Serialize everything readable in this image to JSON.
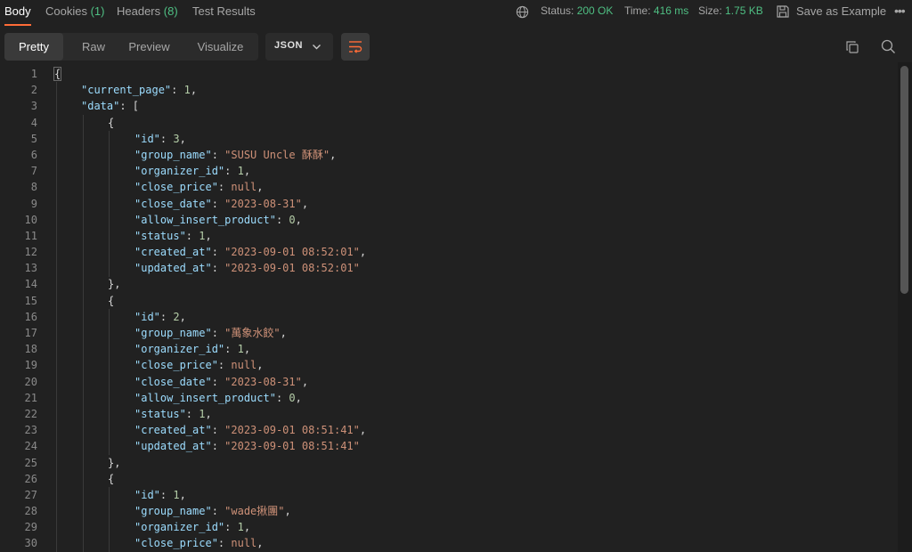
{
  "tabs": {
    "body": "Body",
    "cookies_label": "Cookies",
    "cookies_count": "(1)",
    "headers_label": "Headers",
    "headers_count": "(8)",
    "test_results": "Test Results"
  },
  "status_bar": {
    "status_label": "Status:",
    "status_value": "200 OK",
    "time_label": "Time:",
    "time_value": "416 ms",
    "size_label": "Size:",
    "size_value": "1.75 KB",
    "save_label": "Save as Example",
    "more": "•••"
  },
  "toolbar": {
    "views": [
      "Pretty",
      "Raw",
      "Preview",
      "Visualize"
    ],
    "active_view": "Pretty",
    "format": "JSON"
  },
  "colors": {
    "accent": "#ff6c37",
    "success": "#4fbf83",
    "key": "#9cdcfe",
    "string": "#ce9178",
    "number": "#b5cea8"
  },
  "icons": [
    "globe-icon",
    "save-icon",
    "chevron-down-icon",
    "wrap-lines-icon",
    "copy-icon",
    "search-icon",
    "more-icon"
  ],
  "code": {
    "lines": [
      {
        "n": "1",
        "indent": 0,
        "tokens": [
          [
            "pun",
            "{"
          ]
        ]
      },
      {
        "n": "2",
        "indent": 1,
        "tokens": [
          [
            "key",
            "\"current_page\""
          ],
          [
            "pun",
            ": "
          ],
          [
            "num",
            "1"
          ],
          [
            "pun",
            ","
          ]
        ]
      },
      {
        "n": "3",
        "indent": 1,
        "tokens": [
          [
            "key",
            "\"data\""
          ],
          [
            "pun",
            ": ["
          ]
        ]
      },
      {
        "n": "4",
        "indent": 2,
        "tokens": [
          [
            "pun",
            "{"
          ]
        ]
      },
      {
        "n": "5",
        "indent": 3,
        "tokens": [
          [
            "key",
            "\"id\""
          ],
          [
            "pun",
            ": "
          ],
          [
            "num",
            "3"
          ],
          [
            "pun",
            ","
          ]
        ]
      },
      {
        "n": "6",
        "indent": 3,
        "tokens": [
          [
            "key",
            "\"group_name\""
          ],
          [
            "pun",
            ": "
          ],
          [
            "str",
            "\"SUSU Uncle 酥酥\""
          ],
          [
            "pun",
            ","
          ]
        ]
      },
      {
        "n": "7",
        "indent": 3,
        "tokens": [
          [
            "key",
            "\"organizer_id\""
          ],
          [
            "pun",
            ": "
          ],
          [
            "num",
            "1"
          ],
          [
            "pun",
            ","
          ]
        ]
      },
      {
        "n": "8",
        "indent": 3,
        "tokens": [
          [
            "key",
            "\"close_price\""
          ],
          [
            "pun",
            ": "
          ],
          [
            "nul",
            "null"
          ],
          [
            "pun",
            ","
          ]
        ]
      },
      {
        "n": "9",
        "indent": 3,
        "tokens": [
          [
            "key",
            "\"close_date\""
          ],
          [
            "pun",
            ": "
          ],
          [
            "str",
            "\"2023-08-31\""
          ],
          [
            "pun",
            ","
          ]
        ]
      },
      {
        "n": "10",
        "indent": 3,
        "tokens": [
          [
            "key",
            "\"allow_insert_product\""
          ],
          [
            "pun",
            ": "
          ],
          [
            "num",
            "0"
          ],
          [
            "pun",
            ","
          ]
        ]
      },
      {
        "n": "11",
        "indent": 3,
        "tokens": [
          [
            "key",
            "\"status\""
          ],
          [
            "pun",
            ": "
          ],
          [
            "num",
            "1"
          ],
          [
            "pun",
            ","
          ]
        ]
      },
      {
        "n": "12",
        "indent": 3,
        "tokens": [
          [
            "key",
            "\"created_at\""
          ],
          [
            "pun",
            ": "
          ],
          [
            "str",
            "\"2023-09-01 08:52:01\""
          ],
          [
            "pun",
            ","
          ]
        ]
      },
      {
        "n": "13",
        "indent": 3,
        "tokens": [
          [
            "key",
            "\"updated_at\""
          ],
          [
            "pun",
            ": "
          ],
          [
            "str",
            "\"2023-09-01 08:52:01\""
          ]
        ]
      },
      {
        "n": "14",
        "indent": 2,
        "tokens": [
          [
            "pun",
            "},"
          ]
        ]
      },
      {
        "n": "15",
        "indent": 2,
        "tokens": [
          [
            "pun",
            "{"
          ]
        ]
      },
      {
        "n": "16",
        "indent": 3,
        "tokens": [
          [
            "key",
            "\"id\""
          ],
          [
            "pun",
            ": "
          ],
          [
            "num",
            "2"
          ],
          [
            "pun",
            ","
          ]
        ]
      },
      {
        "n": "17",
        "indent": 3,
        "tokens": [
          [
            "key",
            "\"group_name\""
          ],
          [
            "pun",
            ": "
          ],
          [
            "str",
            "\"萬象水餃\""
          ],
          [
            "pun",
            ","
          ]
        ]
      },
      {
        "n": "18",
        "indent": 3,
        "tokens": [
          [
            "key",
            "\"organizer_id\""
          ],
          [
            "pun",
            ": "
          ],
          [
            "num",
            "1"
          ],
          [
            "pun",
            ","
          ]
        ]
      },
      {
        "n": "19",
        "indent": 3,
        "tokens": [
          [
            "key",
            "\"close_price\""
          ],
          [
            "pun",
            ": "
          ],
          [
            "nul",
            "null"
          ],
          [
            "pun",
            ","
          ]
        ]
      },
      {
        "n": "20",
        "indent": 3,
        "tokens": [
          [
            "key",
            "\"close_date\""
          ],
          [
            "pun",
            ": "
          ],
          [
            "str",
            "\"2023-08-31\""
          ],
          [
            "pun",
            ","
          ]
        ]
      },
      {
        "n": "21",
        "indent": 3,
        "tokens": [
          [
            "key",
            "\"allow_insert_product\""
          ],
          [
            "pun",
            ": "
          ],
          [
            "num",
            "0"
          ],
          [
            "pun",
            ","
          ]
        ]
      },
      {
        "n": "22",
        "indent": 3,
        "tokens": [
          [
            "key",
            "\"status\""
          ],
          [
            "pun",
            ": "
          ],
          [
            "num",
            "1"
          ],
          [
            "pun",
            ","
          ]
        ]
      },
      {
        "n": "23",
        "indent": 3,
        "tokens": [
          [
            "key",
            "\"created_at\""
          ],
          [
            "pun",
            ": "
          ],
          [
            "str",
            "\"2023-09-01 08:51:41\""
          ],
          [
            "pun",
            ","
          ]
        ]
      },
      {
        "n": "24",
        "indent": 3,
        "tokens": [
          [
            "key",
            "\"updated_at\""
          ],
          [
            "pun",
            ": "
          ],
          [
            "str",
            "\"2023-09-01 08:51:41\""
          ]
        ]
      },
      {
        "n": "25",
        "indent": 2,
        "tokens": [
          [
            "pun",
            "},"
          ]
        ]
      },
      {
        "n": "26",
        "indent": 2,
        "tokens": [
          [
            "pun",
            "{"
          ]
        ]
      },
      {
        "n": "27",
        "indent": 3,
        "tokens": [
          [
            "key",
            "\"id\""
          ],
          [
            "pun",
            ": "
          ],
          [
            "num",
            "1"
          ],
          [
            "pun",
            ","
          ]
        ]
      },
      {
        "n": "28",
        "indent": 3,
        "tokens": [
          [
            "key",
            "\"group_name\""
          ],
          [
            "pun",
            ": "
          ],
          [
            "str",
            "\"wade揪團\""
          ],
          [
            "pun",
            ","
          ]
        ]
      },
      {
        "n": "29",
        "indent": 3,
        "tokens": [
          [
            "key",
            "\"organizer_id\""
          ],
          [
            "pun",
            ": "
          ],
          [
            "num",
            "1"
          ],
          [
            "pun",
            ","
          ]
        ]
      },
      {
        "n": "30",
        "indent": 3,
        "tokens": [
          [
            "key",
            "\"close_price\""
          ],
          [
            "pun",
            ": "
          ],
          [
            "nul",
            "null"
          ],
          [
            "pun",
            ","
          ]
        ]
      }
    ]
  }
}
